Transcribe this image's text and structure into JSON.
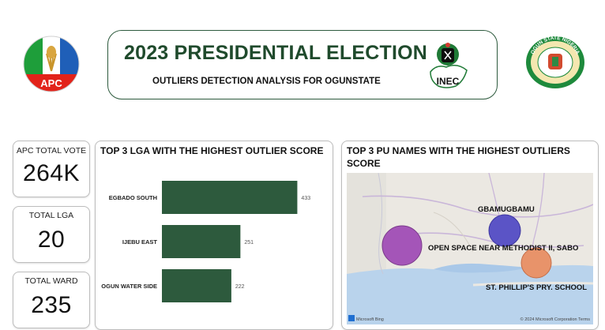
{
  "header": {
    "title": "2023 PRESIDENTIAL ELECTION",
    "subtitle": "OUTLIERS DETECTION ANALYSIS FOR OGUNSTATE",
    "apc_logo_text": "APC",
    "inec_logo_text": "INEC",
    "ogun_logo_text": "OGUN STATE NIGERIA"
  },
  "kpis": [
    {
      "label": "APC TOTAL VOTE",
      "value": "264K"
    },
    {
      "label": "TOTAL LGA",
      "value": "20"
    },
    {
      "label": "TOTAL WARD",
      "value": "235"
    }
  ],
  "lga_panel": {
    "title": "TOP 3 LGA WITH THE HIGHEST OUTLIER SCORE"
  },
  "pu_panel": {
    "title": "TOP 3 PU NAMES WITH THE HIGHEST OUTLIERS SCORE",
    "map_attribution_left": "Microsoft Bing",
    "map_attribution_right": "© 2024 Microsoft Corporation  Terms",
    "points": [
      {
        "label": "GBAMUGBAMU",
        "color": "#5b54c6"
      },
      {
        "label": "OPEN SPACE NEAR METHODIST II, SABO",
        "color": "#a455b8"
      },
      {
        "label": "ST. PHILLIP'S PRY. SCHOOL",
        "color": "#e8936a"
      }
    ]
  },
  "chart_data": {
    "type": "bar",
    "orientation": "horizontal",
    "categories": [
      "EGBADO SOUTH",
      "IJEBU EAST",
      "OGUN WATER SIDE"
    ],
    "values": [
      433,
      251,
      222
    ],
    "title": "TOP 3 LGA WITH THE HIGHEST OUTLIER SCORE",
    "bar_color": "#2d5a3d",
    "grid": false
  }
}
